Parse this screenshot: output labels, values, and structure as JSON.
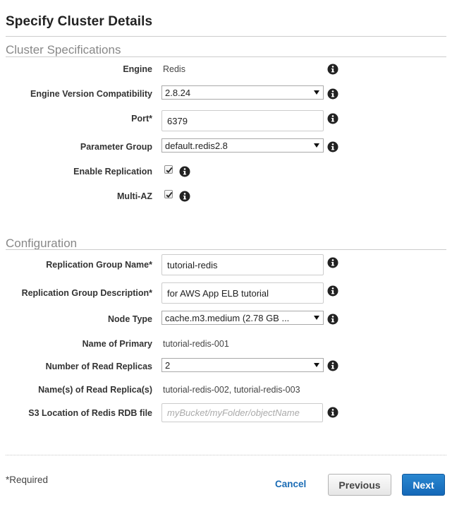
{
  "page": {
    "title": "Specify Cluster Details"
  },
  "cluster_specs": {
    "heading": "Cluster Specifications",
    "engine": {
      "label": "Engine",
      "value": "Redis"
    },
    "engine_version": {
      "label": "Engine Version Compatibility",
      "value": "2.8.24"
    },
    "port": {
      "label": "Port*",
      "value": "6379"
    },
    "parameter_group": {
      "label": "Parameter Group",
      "value": "default.redis2.8"
    },
    "enable_replication": {
      "label": "Enable Replication",
      "checked": true
    },
    "multi_az": {
      "label": "Multi-AZ",
      "checked": true
    }
  },
  "configuration": {
    "heading": "Configuration",
    "replication_group_name": {
      "label": "Replication Group Name*",
      "value": "tutorial-redis"
    },
    "replication_group_description": {
      "label": "Replication Group Description*",
      "value": "for AWS App ELB tutorial"
    },
    "node_type": {
      "label": "Node Type",
      "value": "cache.m3.medium (2.78 GB ..."
    },
    "name_of_primary": {
      "label": "Name of Primary",
      "value": "tutorial-redis-001"
    },
    "number_of_read_replicas": {
      "label": "Number of Read Replicas",
      "value": "2"
    },
    "read_replica_names": {
      "label": "Name(s) of Read Replica(s)",
      "value": "tutorial-redis-002, tutorial-redis-003"
    },
    "s3_location": {
      "label": "S3 Location of Redis RDB file",
      "value": "",
      "placeholder": "myBucket/myFolder/objectName"
    }
  },
  "footer": {
    "required_note": "*Required",
    "cancel_label": "Cancel",
    "previous_label": "Previous",
    "next_label": "Next"
  },
  "icons": {
    "info": "info-circle-icon",
    "caret": "caret-down-icon",
    "check": "checkmark-icon"
  },
  "colors": {
    "primary_button": "#1b72bf",
    "link": "#1b6cb5",
    "section_heading": "#888888"
  }
}
